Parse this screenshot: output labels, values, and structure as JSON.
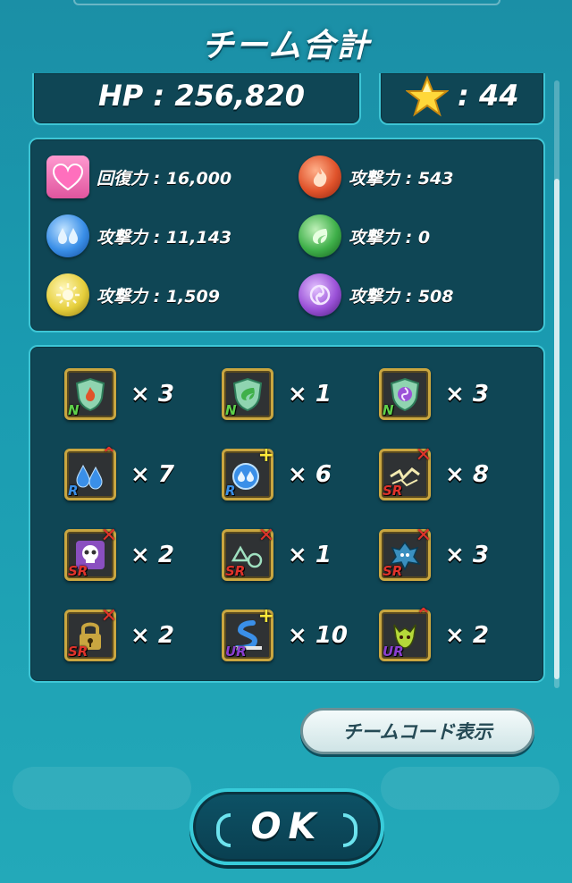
{
  "title": "チーム合計",
  "summary": {
    "hp": "HP : 256,820",
    "stars": ": 44"
  },
  "powers": [
    {
      "icon": "heart-icon",
      "label": "回復力 : 16,000",
      "color": "#f06bb0"
    },
    {
      "icon": "fire-orb-icon",
      "label": "攻撃力 : 543",
      "color": "#e0532b"
    },
    {
      "icon": "water-orb-icon",
      "label": "攻撃力 : 11,143",
      "color": "#3a8fe8"
    },
    {
      "icon": "wood-orb-icon",
      "label": "攻撃力 : 0",
      "color": "#3fb04a"
    },
    {
      "icon": "light-orb-icon",
      "label": "攻撃力 : 1,509",
      "color": "#e6cf3c"
    },
    {
      "icon": "dark-orb-icon",
      "label": "攻撃力 : 508",
      "color": "#9b52d8"
    }
  ],
  "abilities": [
    {
      "icon": "fire-shield-icon",
      "rank": "N",
      "count": "× 3"
    },
    {
      "icon": "wood-shield-icon",
      "rank": "N",
      "count": "× 1"
    },
    {
      "icon": "dark-shield-icon",
      "rank": "N",
      "count": "× 3"
    },
    {
      "icon": "water-attack-up-icon",
      "rank": "R",
      "count": "× 7"
    },
    {
      "icon": "water-heal-plus-icon",
      "rank": "R",
      "count": "× 6"
    },
    {
      "icon": "electric-block-icon",
      "rank": "SR",
      "count": "× 8"
    },
    {
      "icon": "poison-block-icon",
      "rank": "SR",
      "count": "× 2"
    },
    {
      "icon": "warp-block-icon",
      "rank": "SR",
      "count": "× 1"
    },
    {
      "icon": "curse-block-icon",
      "rank": "SR",
      "count": "× 3"
    },
    {
      "icon": "lock-block-icon",
      "rank": "SR",
      "count": "× 2"
    },
    {
      "icon": "speed-plus-icon",
      "rank": "UR",
      "count": "× 10"
    },
    {
      "icon": "demon-attack-up-icon",
      "rank": "UR",
      "count": "× 2"
    }
  ],
  "buttons": {
    "team_code": "チームコード表示",
    "ok": "OK"
  },
  "colors": {
    "accent": "#3ec6d6",
    "panel": "#0f4655",
    "badge_border": "#c9a640",
    "rank_N": "#5fd14a",
    "rank_R": "#3a8fe8",
    "rank_SR": "#e0332b",
    "rank_UR": "#8a3fd0"
  }
}
